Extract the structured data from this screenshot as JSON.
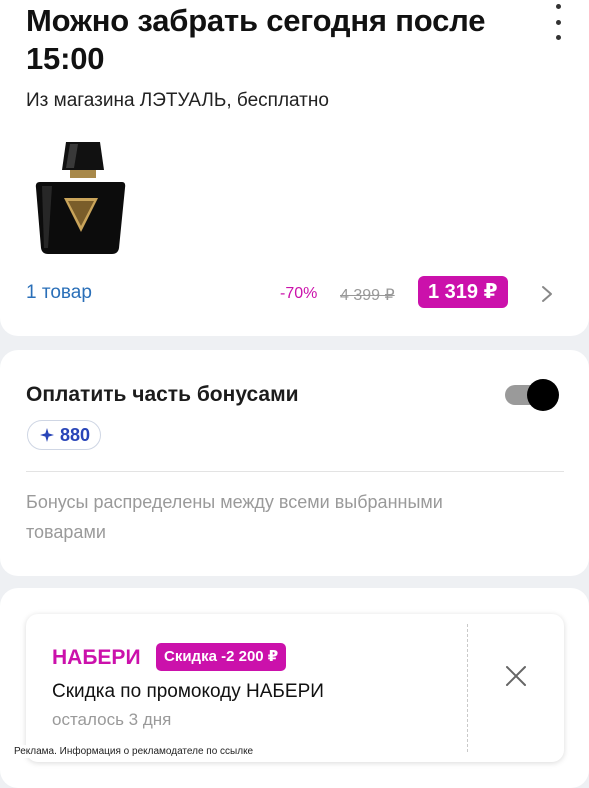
{
  "pickup": {
    "title": "Можно забрать сегодня после 15:00",
    "subtitle": "Из магазина ЛЭТУАЛЬ, бесплатно",
    "items_count": "1 товар",
    "discount": "-70%",
    "old_price": "4 399 ₽",
    "new_price": "1 319 ₽"
  },
  "bonus": {
    "title": "Оплатить часть бонусами",
    "toggle_on": true,
    "amount": "880",
    "note": "Бонусы распределены между всеми выбранными товарами"
  },
  "promo": {
    "code": "НАБЕРИ",
    "badge": "Скидка -2 200 ₽",
    "description": "Скидка по промокоду НАБЕРИ",
    "time_left": "осталось 3 дня"
  },
  "ad_notice": "Реклама. Информация о рекламодателе по ссылке",
  "icons": {
    "more": "more-vertical-icon",
    "chevron": "chevron-right-icon",
    "bonus": "sparkle-icon",
    "close": "close-icon"
  },
  "colors": {
    "accent": "#cb11ab",
    "link": "#2a6fb8",
    "bonus": "#2945b8"
  }
}
